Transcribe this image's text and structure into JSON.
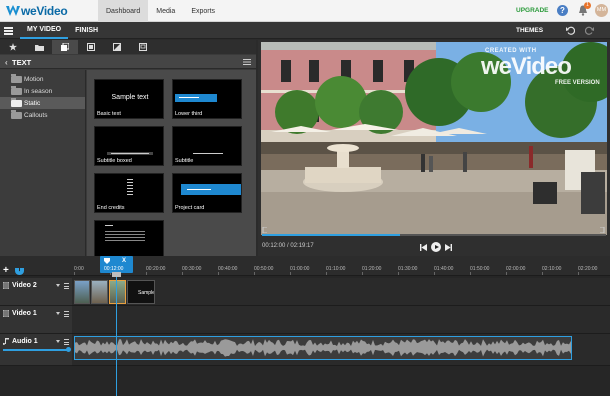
{
  "app": {
    "logo_text": "weVideo",
    "nav": [
      "Dashboard",
      "Media",
      "Exports"
    ],
    "active_nav": "Dashboard",
    "upgrade": "UPGRADE",
    "help": "?",
    "notifications": "1",
    "avatar": "MM"
  },
  "subbar": {
    "tabs": [
      "MY VIDEO",
      "FINISH"
    ],
    "active_tab": "MY VIDEO",
    "themes": "THEMES"
  },
  "panel": {
    "title": "TEXT",
    "categories": [
      "Motion",
      "In season",
      "Static",
      "Callouts"
    ],
    "active_category": "Static",
    "tiles": [
      {
        "label": "Basic text",
        "preview": "Sample text"
      },
      {
        "label": "Lower third",
        "preview": ""
      },
      {
        "label": "Subtitle boxed",
        "preview": ""
      },
      {
        "label": "Subtitle",
        "preview": ""
      },
      {
        "label": "End credits",
        "preview": ""
      },
      {
        "label": "Project card",
        "preview": ""
      },
      {
        "label": "",
        "preview": ""
      }
    ]
  },
  "preview": {
    "watermark_top": "CREATED WITH",
    "watermark_logo": "weVideo",
    "watermark_sub": "FREE VERSION",
    "time": "00:12:00 / 02:19:17",
    "progress_fraction": 0.4
  },
  "timeline": {
    "ticks": [
      "0:00",
      "00:10:00",
      "00:20:00",
      "00:30:00",
      "00:40:00",
      "00:50:00",
      "01:00:00",
      "01:10:00",
      "01:20:00",
      "01:30:00",
      "01:40:00",
      "01:50:00",
      "02:00:00",
      "02:10:00",
      "02:20:00"
    ],
    "playhead_time": "00:12:00",
    "tracks": [
      {
        "name": "Video 2",
        "type": "video"
      },
      {
        "name": "Video 1",
        "type": "video"
      },
      {
        "name": "Audio 1",
        "type": "audio"
      }
    ],
    "sample_clip_label": "Sample",
    "close": "X"
  }
}
